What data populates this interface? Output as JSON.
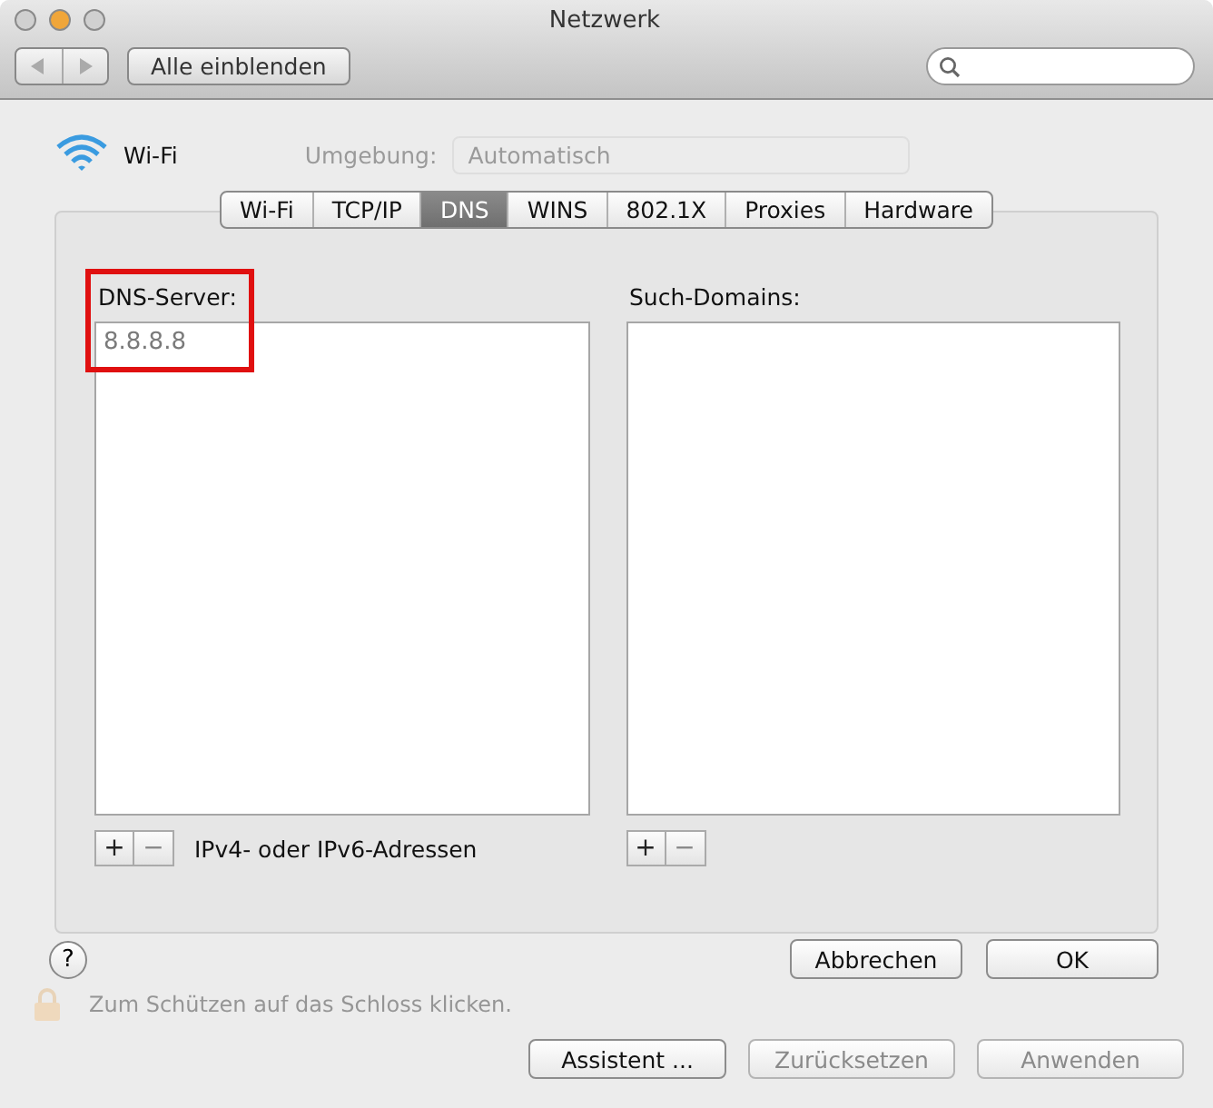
{
  "window": {
    "title": "Netzwerk"
  },
  "toolbar": {
    "show_all": "Alle einblenden"
  },
  "service": {
    "name": "Wi-Fi"
  },
  "location": {
    "label": "Umgebung:",
    "value": "Automatisch"
  },
  "tabs": [
    {
      "label": "Wi-Fi",
      "selected": false
    },
    {
      "label": "TCP/IP",
      "selected": false
    },
    {
      "label": "DNS",
      "selected": true
    },
    {
      "label": "WINS",
      "selected": false
    },
    {
      "label": "802.1X",
      "selected": false
    },
    {
      "label": "Proxies",
      "selected": false
    },
    {
      "label": "Hardware",
      "selected": false
    }
  ],
  "dns_servers": {
    "label": "DNS-Server:",
    "entries": [
      "8.8.8.8"
    ],
    "add": "+",
    "remove": "−",
    "hint": "IPv4- oder IPv6-Adressen"
  },
  "search_domains": {
    "label": "Such-Domains:",
    "add": "+",
    "remove": "−"
  },
  "help": "?",
  "dialog_buttons": [
    "Abbrechen",
    "OK"
  ],
  "lock_hint": "Zum Schützen auf das Schloss klicken.",
  "footer_buttons": [
    {
      "label": "Assistent ...",
      "disabled": false
    },
    {
      "label": "Zurücksetzen",
      "disabled": true
    },
    {
      "label": "Anwenden",
      "disabled": true
    }
  ]
}
